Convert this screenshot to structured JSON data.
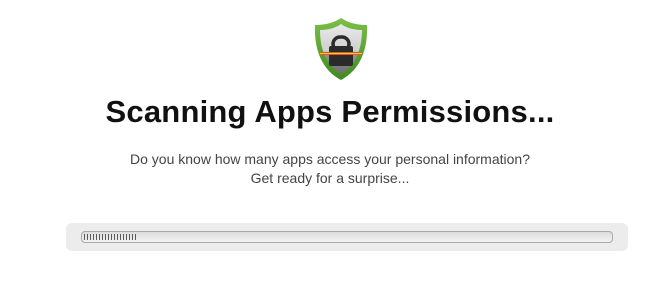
{
  "header": {
    "icon": "shield-lock-scan-icon",
    "title": "Scanning Apps Permissions...",
    "subtitle_line1": "Do you know how many apps access your personal information?",
    "subtitle_line2": "Get ready for a surprise..."
  },
  "progress": {
    "fraction": 0.1
  },
  "colors": {
    "shield_green": "#4f9a2a",
    "scan_line": "#e05a1a",
    "text_dark": "#111111",
    "text_muted": "#444444"
  }
}
